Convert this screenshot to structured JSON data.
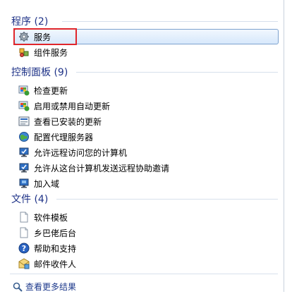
{
  "groups": [
    {
      "title": "程序 (2)",
      "items": [
        {
          "label": "服务",
          "icon": "gear-icon"
        },
        {
          "label": "组件服务",
          "icon": "component-services-icon"
        }
      ]
    },
    {
      "title": "控制面板 (9)",
      "items": [
        {
          "label": "检查更新",
          "icon": "windows-update-icon"
        },
        {
          "label": "启用或禁用自动更新",
          "icon": "windows-update-icon"
        },
        {
          "label": "查看已安装的更新",
          "icon": "installed-updates-icon"
        },
        {
          "label": "配置代理服务器",
          "icon": "proxy-globe-icon"
        },
        {
          "label": "允许远程访问您的计算机",
          "icon": "remote-computer-icon"
        },
        {
          "label": "允许从这台计算机发送远程协助邀请",
          "icon": "remote-computer-icon"
        },
        {
          "label": "加入域",
          "icon": "domain-computer-icon"
        }
      ]
    },
    {
      "title": "文件 (4)",
      "items": [
        {
          "label": "软件模板",
          "icon": "document-icon"
        },
        {
          "label": "乡巴佬后台",
          "icon": "document-icon"
        },
        {
          "label": "帮助和支持",
          "icon": "help-icon"
        },
        {
          "label": "邮件收件人",
          "icon": "mail-recipient-icon"
        }
      ]
    }
  ],
  "see_more": {
    "label": "查看更多结果",
    "icon": "search-icon"
  },
  "colors": {
    "header": "#1e3287",
    "highlight": "#e0262b",
    "selected_border": "#7da2ce"
  }
}
